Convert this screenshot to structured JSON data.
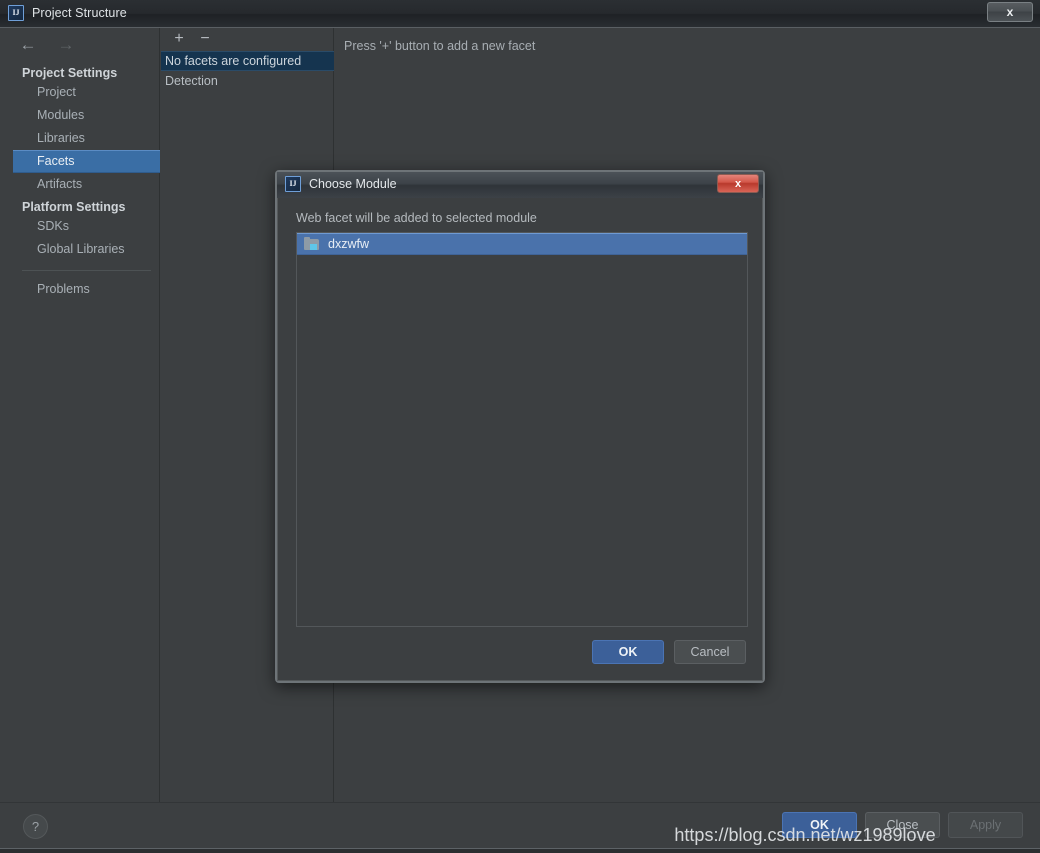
{
  "main_window": {
    "title": "Project Structure",
    "logo_icon": "intellij-idea-logo-icon",
    "close_label": "x"
  },
  "navigation": {
    "back_icon": "arrow-left-icon",
    "forward_icon": "arrow-right-icon"
  },
  "sidebar": {
    "groups": [
      {
        "header": "Project Settings",
        "items": [
          {
            "label": "Project",
            "selected": false
          },
          {
            "label": "Modules",
            "selected": false
          },
          {
            "label": "Libraries",
            "selected": false
          },
          {
            "label": "Facets",
            "selected": true
          },
          {
            "label": "Artifacts",
            "selected": false
          }
        ]
      },
      {
        "header": "Platform Settings",
        "items": [
          {
            "label": "SDKs",
            "selected": false
          },
          {
            "label": "Global Libraries",
            "selected": false
          }
        ]
      }
    ],
    "extra_items": [
      {
        "label": "Problems",
        "selected": false
      }
    ]
  },
  "facets_panel": {
    "add_button_label": "+",
    "remove_button_label": "−",
    "rows": [
      {
        "label": "No facets are configured",
        "selected": true
      },
      {
        "label": "Detection",
        "selected": false
      }
    ]
  },
  "right_pane": {
    "hint": "Press '+' button to add a new facet"
  },
  "footer": {
    "help_label": "?",
    "buttons": [
      {
        "label": "OK",
        "style": "default"
      },
      {
        "label": "Close",
        "style": "normal"
      },
      {
        "label": "Apply",
        "style": "disabled"
      }
    ]
  },
  "dialog": {
    "title": "Choose Module",
    "logo_icon": "intellij-idea-logo-icon",
    "close_label": "x",
    "description": "Web facet will be added to selected module",
    "list": [
      {
        "label": "dxzwfw",
        "icon": "module-folder-icon",
        "selected": true
      }
    ],
    "buttons": [
      {
        "label": "OK",
        "style": "default"
      },
      {
        "label": "Cancel",
        "style": "normal"
      }
    ]
  },
  "watermark": {
    "text": "https://blog.csdn.net/wz1989love"
  },
  "colors": {
    "window_background": "#3c3f41",
    "selection_blue": "#3a6ea5",
    "dialog_selection_blue": "#4a72ab",
    "facet_selection": "#15344f",
    "default_button": "#3c6099",
    "close_button_red": "#d3574a",
    "text_primary": "#b9bfc4",
    "text_heading": "#cfd4d8"
  }
}
